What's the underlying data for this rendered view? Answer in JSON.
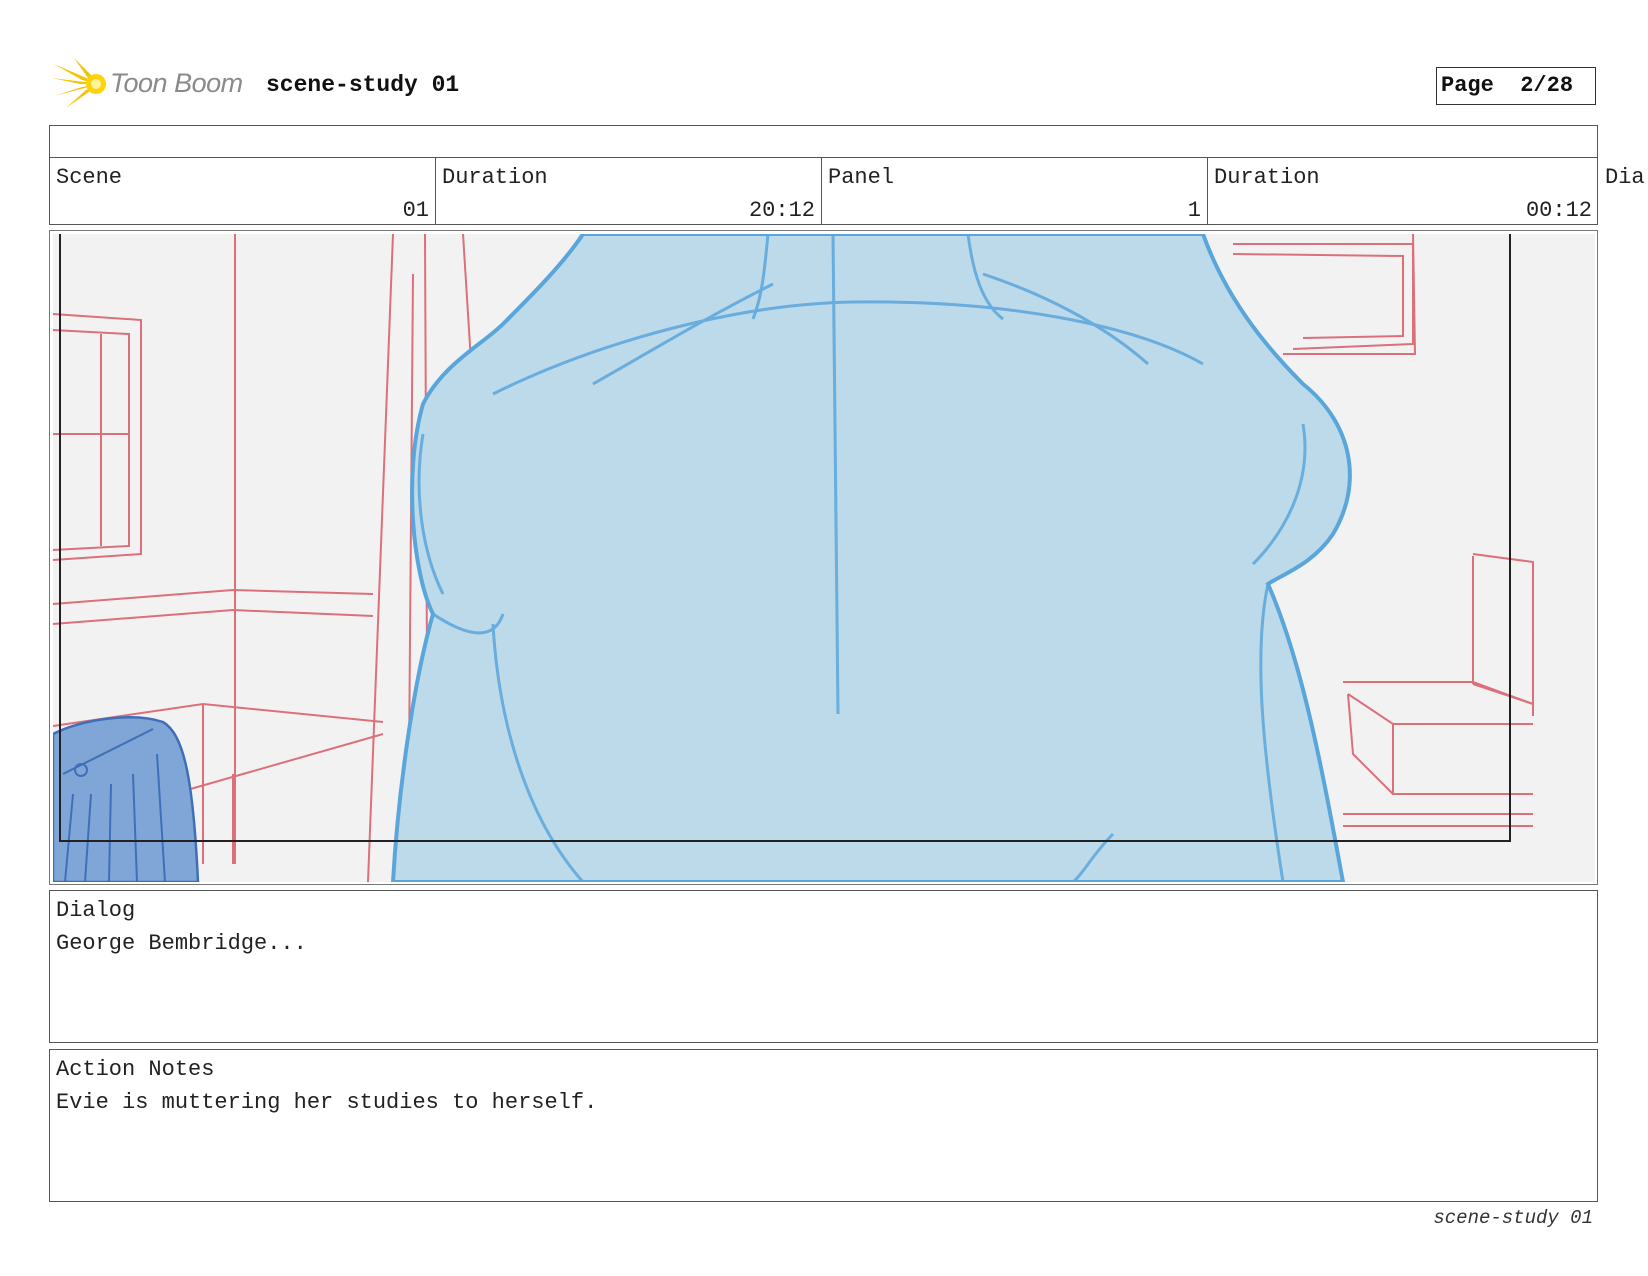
{
  "header": {
    "logo_text": "Toon Boom",
    "document_title": "scene-study 01",
    "page_label": "Page  2/28"
  },
  "info": {
    "cells": [
      {
        "label": "Scene",
        "value": "01"
      },
      {
        "label": "Duration",
        "value": "20:12"
      },
      {
        "label": "Panel",
        "value": "1"
      },
      {
        "label": "Duration",
        "value": "00:12"
      }
    ],
    "overflow_label": "Dia"
  },
  "panel_image": {
    "colors": {
      "character_fill": "#bcdaea",
      "character_line": "#5aa6db",
      "background_line": "#d9626e",
      "background_fill": "#f2f2f2",
      "prop_fill": "#7fa6d6",
      "prop_line": "#3f6fb8"
    }
  },
  "dialog": {
    "label": "Dialog",
    "text": "George Bembridge..."
  },
  "action_notes": {
    "label": "Action Notes",
    "text": "Evie is muttering her studies to herself."
  },
  "footer": {
    "text": "scene-study 01"
  }
}
